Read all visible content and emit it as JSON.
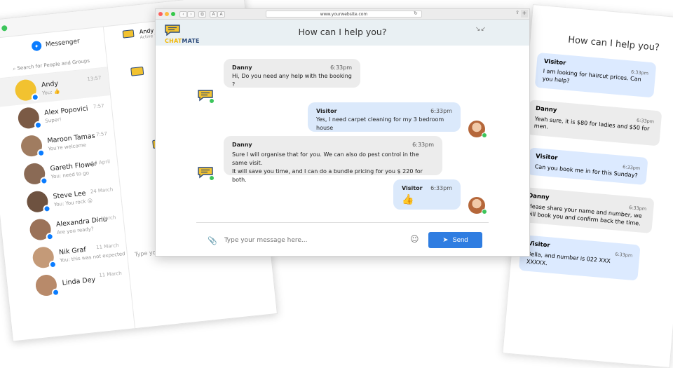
{
  "browser": {
    "url": "www.yourwebsite.com",
    "nav_back": "‹",
    "nav_fwd": "›",
    "tab_icon": "⧉",
    "font_small": "A",
    "font_large": "A"
  },
  "widget": {
    "logo_text_1": "CHAT",
    "logo_text_2": "MATE",
    "title": "How can I help you?",
    "minimize_icon": "↘↙"
  },
  "messages": [
    {
      "sender": "Danny",
      "time": "6:33pm",
      "text": "Hi, Do you need any help with the booking ?"
    },
    {
      "sender": "Visitor",
      "time": "6:33pm",
      "text": "Yes, I need carpet cleaning for my 3 bedroom house"
    },
    {
      "sender": "Danny",
      "time": "6:33pm",
      "line1": "Sure I will organise that for you. We can also do pest control in the same visit.",
      "line2": "It will save you time, and I can do a bundle pricing for you $ 220 for both."
    },
    {
      "sender": "Visitor",
      "time": "6:33pm"
    }
  ],
  "composer": {
    "placeholder": "Type your message here...",
    "send_label": "Send"
  },
  "messenger": {
    "app_name": "Messenger",
    "search_placeholder": "Search for People and Groups",
    "active_chat": {
      "name": "Andy",
      "status": "Active 1h ago"
    },
    "type_placeholder": "Type your message here...",
    "contacts": [
      {
        "name": "Andy",
        "preview": "You:",
        "time": "13:57"
      },
      {
        "name": "Alex Popovici",
        "preview": "Super!",
        "time": "7:57"
      },
      {
        "name": "Maroon Tamas",
        "preview": "You're welcome",
        "time": "7:57"
      },
      {
        "name": "Gareth Flower",
        "preview": "You: need to go",
        "time": "14 April"
      },
      {
        "name": "Steve Lee",
        "preview": "You: You rock",
        "time": "24 March"
      },
      {
        "name": "Alexandra Dinu",
        "preview": "Are you ready?",
        "time": "11 March"
      },
      {
        "name": "Nik Graf",
        "preview": "You: this was not expected",
        "time": "11 March"
      },
      {
        "name": "Linda Dey",
        "preview": "",
        "time": "11 March"
      }
    ]
  },
  "right_panel": {
    "title": "How can I help you?",
    "messages": [
      {
        "sender": "Visitor",
        "time": "6:33pm",
        "text": "I am looking for haircut prices. Can you help?"
      },
      {
        "sender": "Danny",
        "time": "6:33pm",
        "text": "Yeah sure, it is $80 for ladies and $50 for men."
      },
      {
        "sender": "Visitor",
        "time": "6:33pm",
        "text": "Can you book me in for this Sunday?"
      },
      {
        "sender": "Danny",
        "time": "6:33pm",
        "text": "Please share your name and number, we will book you and confirm back the time."
      },
      {
        "sender": "Visitor",
        "time": "6:33pm",
        "text": "Bella, and number is 022 XXX XXXXX."
      }
    ]
  },
  "colors": {
    "accent": "#2f7de1",
    "visitor_bubble": "#dbe9fb",
    "agent_bubble": "#ececec",
    "header_bg": "#e9f0f3",
    "online": "#3cc55b",
    "logo_yellow": "#f2b705",
    "logo_navy": "#2b4a7a",
    "messenger_blue": "#0a7cff"
  }
}
